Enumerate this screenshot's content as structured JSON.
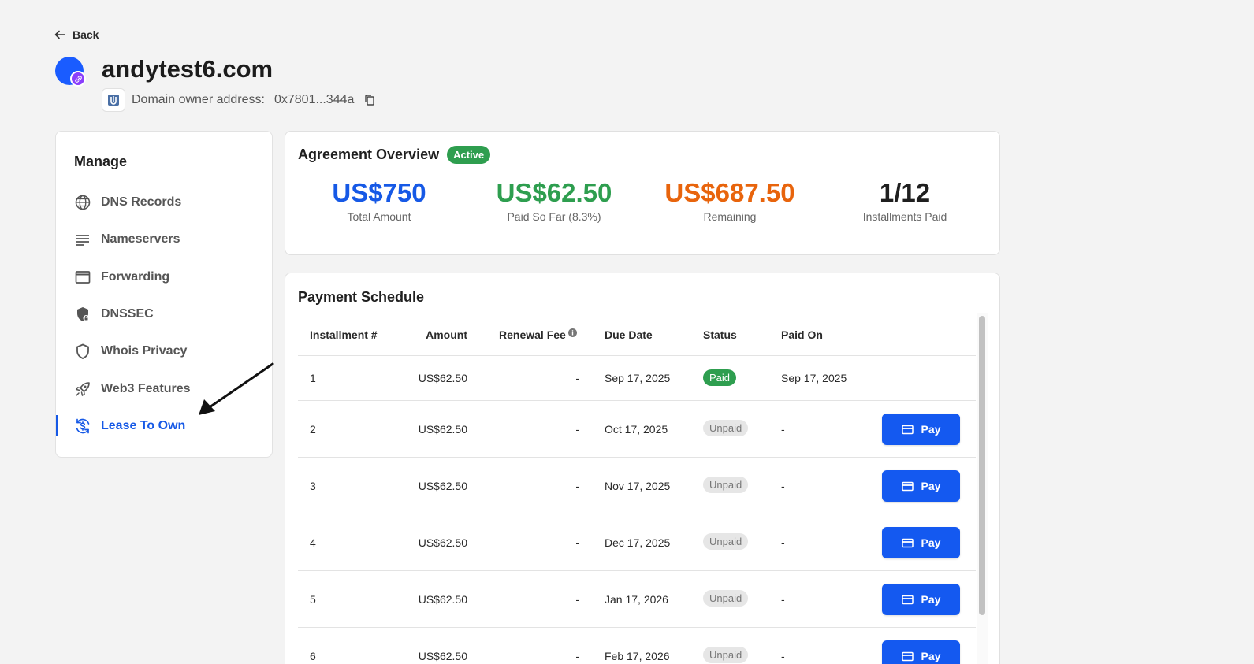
{
  "nav": {
    "back_label": "Back"
  },
  "domain": {
    "name": "andytest6.com",
    "owner_label": "Domain owner address:",
    "owner_address": "0x7801...344a"
  },
  "sidebar": {
    "title": "Manage",
    "items": [
      {
        "label": "DNS Records",
        "icon": "globe-icon"
      },
      {
        "label": "Nameservers",
        "icon": "list-icon"
      },
      {
        "label": "Forwarding",
        "icon": "window-icon"
      },
      {
        "label": "DNSSEC",
        "icon": "shield-lock-icon"
      },
      {
        "label": "Whois Privacy",
        "icon": "shield-icon"
      },
      {
        "label": "Web3 Features",
        "icon": "rocket-icon"
      },
      {
        "label": "Lease To Own",
        "icon": "dollar-cycle-icon",
        "active": true
      }
    ]
  },
  "overview": {
    "title": "Agreement Overview",
    "status": "Active",
    "stats": [
      {
        "value": "US$750",
        "label": "Total Amount",
        "color": "#1659e6"
      },
      {
        "value": "US$62.50",
        "label": "Paid So Far (8.3%)",
        "color": "#2e9e4f"
      },
      {
        "value": "US$687.50",
        "label": "Remaining",
        "color": "#e8640c"
      },
      {
        "value": "1/12",
        "label": "Installments Paid",
        "color": "#1f1f1f"
      }
    ]
  },
  "schedule": {
    "title": "Payment Schedule",
    "headers": {
      "installment": "Installment #",
      "amount": "Amount",
      "renewal_fee": "Renewal Fee",
      "due_date": "Due Date",
      "status": "Status",
      "paid_on": "Paid On"
    },
    "pay_label": "Pay",
    "rows": [
      {
        "num": "1",
        "amount": "US$62.50",
        "fee": "-",
        "due": "Sep 17, 2025",
        "status": "Paid",
        "paid_on": "Sep 17, 2025"
      },
      {
        "num": "2",
        "amount": "US$62.50",
        "fee": "-",
        "due": "Oct 17, 2025",
        "status": "Unpaid",
        "paid_on": "-"
      },
      {
        "num": "3",
        "amount": "US$62.50",
        "fee": "-",
        "due": "Nov 17, 2025",
        "status": "Unpaid",
        "paid_on": "-"
      },
      {
        "num": "4",
        "amount": "US$62.50",
        "fee": "-",
        "due": "Dec 17, 2025",
        "status": "Unpaid",
        "paid_on": "-"
      },
      {
        "num": "5",
        "amount": "US$62.50",
        "fee": "-",
        "due": "Jan 17, 2026",
        "status": "Unpaid",
        "paid_on": "-"
      },
      {
        "num": "6",
        "amount": "US$62.50",
        "fee": "-",
        "due": "Feb 17, 2026",
        "status": "Unpaid",
        "paid_on": "-"
      }
    ]
  }
}
